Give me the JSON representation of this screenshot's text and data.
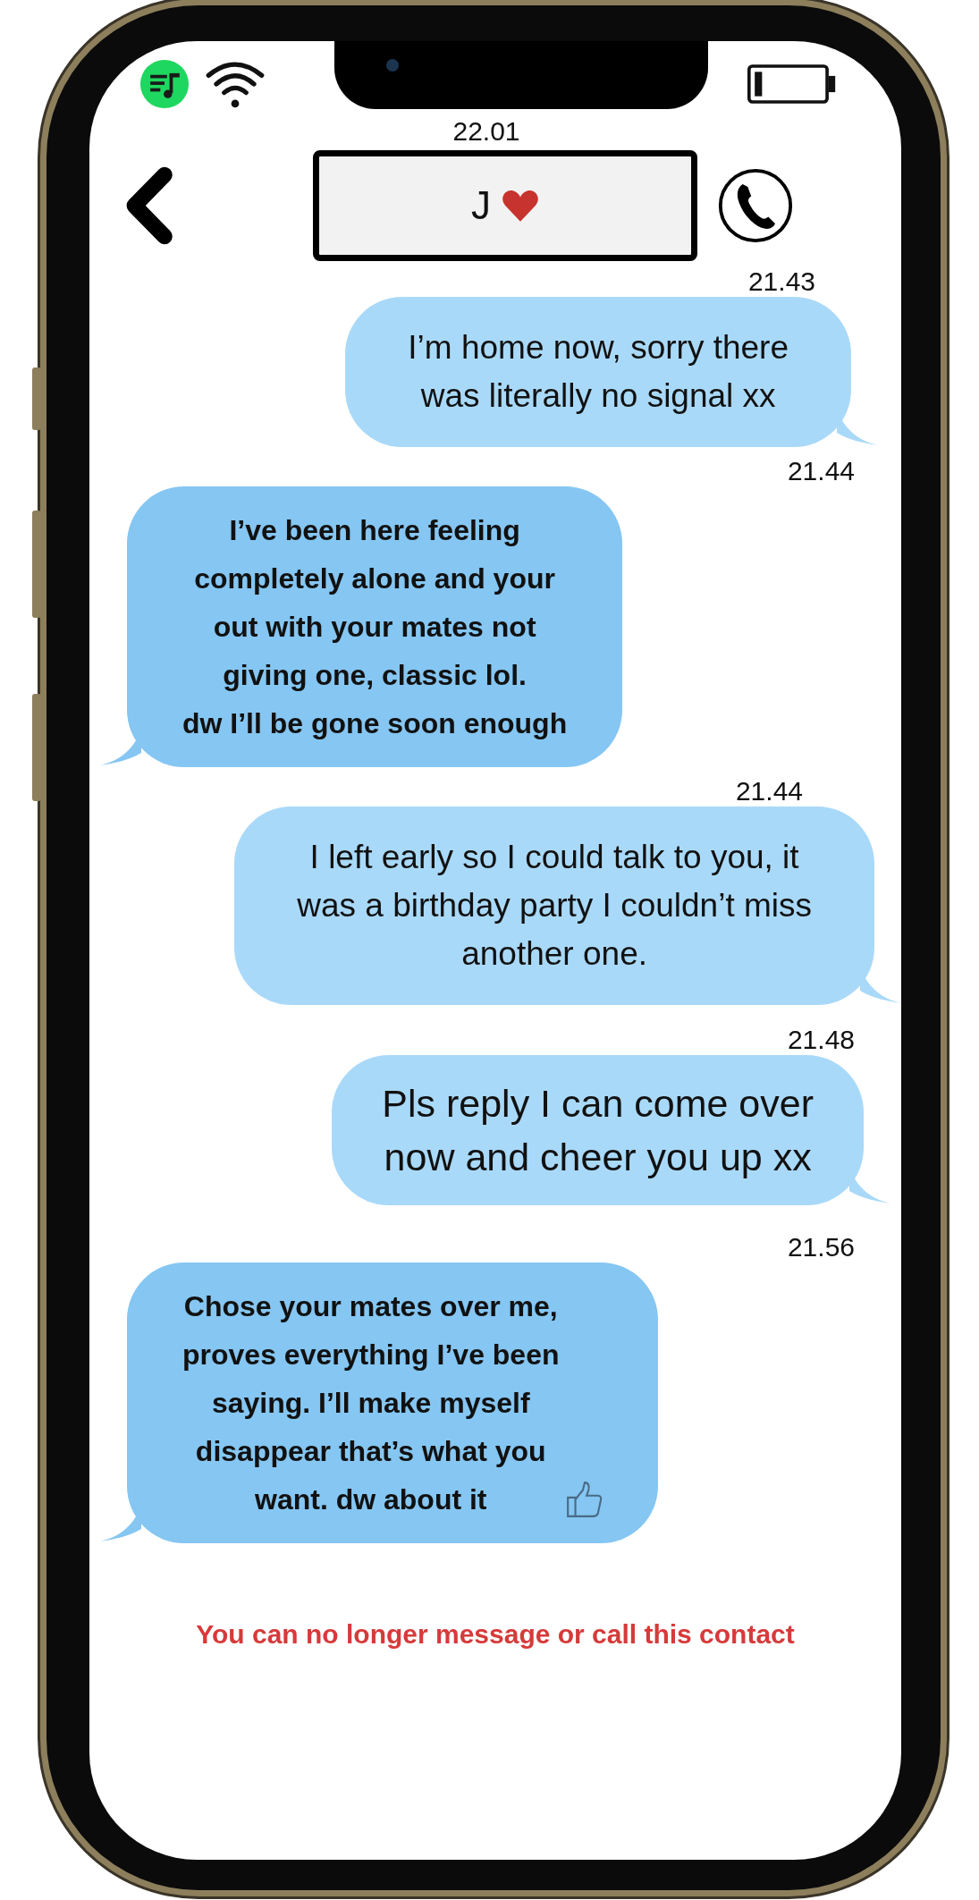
{
  "status_bar": {
    "time": "22.01"
  },
  "contact": {
    "name": "J"
  },
  "messages": [
    {
      "time": "21.43",
      "kind": "sent",
      "thumbs_up": false,
      "text": "I’m home now, sorry there\nwas literally no signal xx"
    },
    {
      "time": "21.44",
      "kind": "received",
      "thumbs_up": false,
      "text": "I’ve been here feeling\ncompletely alone and your\nout with your mates not\ngiving one, classic lol.\ndw I’ll be gone soon enough"
    },
    {
      "time": "21.44",
      "kind": "sent",
      "thumbs_up": false,
      "text": "I left early so I could talk to you, it\nwas a birthday party I couldn’t miss\nanother one."
    },
    {
      "time": "21.48",
      "kind": "sent",
      "thumbs_up": false,
      "text": "Pls reply I can come over\nnow and cheer you up xx"
    },
    {
      "time": "21.56",
      "kind": "received",
      "thumbs_up": true,
      "text": "Chose your mates over me,\nproves everything I’ve been\nsaying. I’ll make myself\ndisappear that’s what you\nwant. dw about it"
    }
  ],
  "notice": "You can no longer message or call this contact"
}
